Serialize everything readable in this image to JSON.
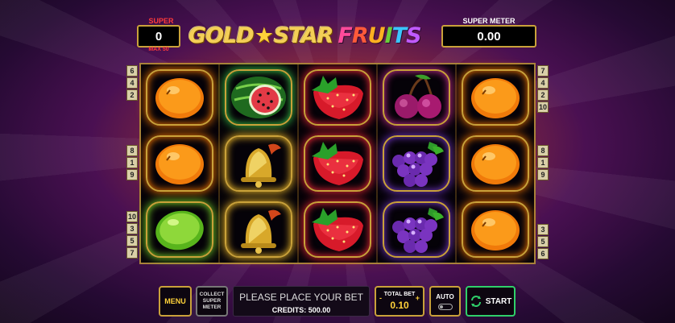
{
  "header": {
    "super_spins_label": "SUPER SPINS",
    "super_spins_value": "0",
    "super_spins_max": "MAX 50",
    "super_meter_label": "SUPER METER",
    "super_meter_value": "0.00",
    "logo_part1": "GOLD",
    "logo_star": "★",
    "logo_part2": "STAR",
    "logo_part3": "FRUITS"
  },
  "reels": [
    [
      "orange",
      "orange",
      "lime"
    ],
    [
      "watermelon",
      "bell",
      "bell"
    ],
    [
      "strawberry",
      "strawberry",
      "strawberry"
    ],
    [
      "cherries",
      "grapes",
      "grapes"
    ],
    [
      "orange",
      "orange",
      "orange"
    ]
  ],
  "paylines": {
    "left": [
      [
        "6",
        "4",
        "2"
      ],
      [
        "8",
        "1",
        "9"
      ],
      [
        "10",
        "3",
        "5",
        "7"
      ]
    ],
    "right": [
      [
        "7",
        "4",
        "2",
        "10"
      ],
      [
        "8",
        "1",
        "9"
      ],
      [
        "3",
        "5",
        "6"
      ]
    ]
  },
  "controls": {
    "menu_label": "MENU",
    "collect_label_1": "COLLECT",
    "collect_label_2": "SUPER",
    "collect_label_3": "METER",
    "message": "PLEASE PLACE YOUR BET",
    "credits": "CREDITS: 500.00",
    "total_bet_label": "TOTAL BET",
    "total_bet_value": "0.10",
    "bet_minus": "-",
    "bet_plus": "+",
    "auto_label": "AUTO",
    "start_label": "START"
  },
  "colors": {
    "frame_gold": "#c9a13a",
    "accent_yellow": "#ffd23a",
    "start_green": "#2fd06a",
    "super_spins_red": "#ff3a3a"
  }
}
